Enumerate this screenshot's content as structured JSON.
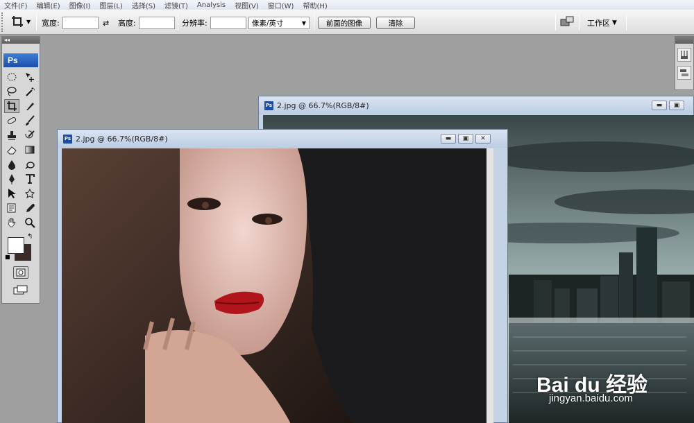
{
  "menu": [
    "文件(F)",
    "编辑(E)",
    "图像(I)",
    "图层(L)",
    "选择(S)",
    "滤镜(T)",
    "Analysis",
    "视图(V)",
    "窗口(W)",
    "帮助(H)"
  ],
  "options": {
    "width_label": "宽度:",
    "width_value": "",
    "height_label": "高度:",
    "height_value": "",
    "resolution_label": "分辨率:",
    "resolution_value": "",
    "unit_selected": "像素/英寸",
    "front_image_button": "前面的图像",
    "clear_button": "清除",
    "workspace_label": "工作区"
  },
  "toolbox": {
    "header": "◂◂",
    "logo": "Ps"
  },
  "windows": {
    "back": {
      "title": "2.jpg @ 66.7%(RGB/8#)"
    },
    "front": {
      "title": "2.jpg @ 66.7%(RGB/8#)"
    }
  },
  "watermark": {
    "brand": "Bai du 经验",
    "url": "jingyan.baidu.com"
  },
  "colors": {
    "foreground": "#ffffff",
    "background": "#3b2a25",
    "ps_blue": "#1b4fa8"
  }
}
